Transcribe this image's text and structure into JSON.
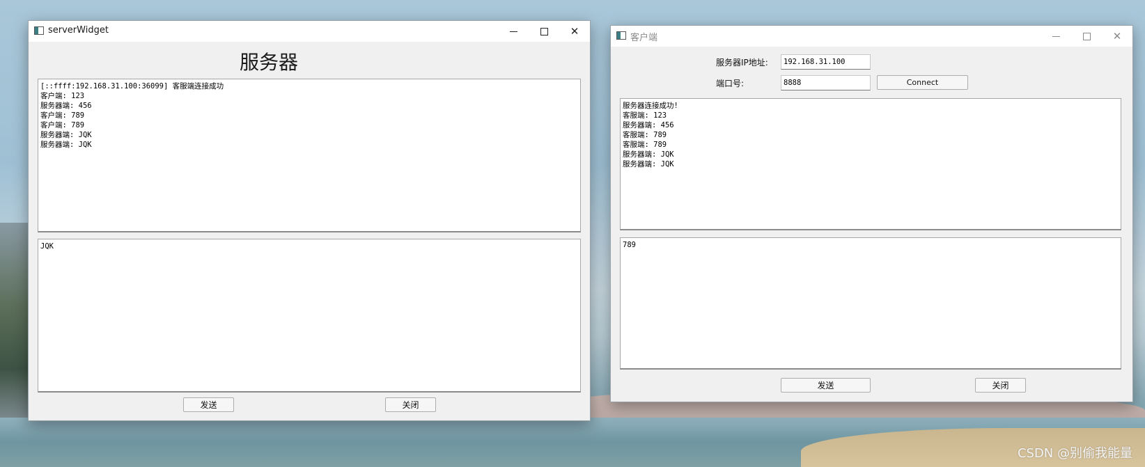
{
  "server": {
    "title": "serverWidget",
    "heading": "服务器",
    "log": [
      "[::ffff:192.168.31.100:36099] 客服端连接成功",
      "客户端: 123",
      "服务器端: 456",
      "客户端: 789",
      "客户端: 789",
      "服务器端: JQK",
      "服务器端: JQK"
    ],
    "input_text": "JQK",
    "send_label": "发送",
    "close_label": "关闭"
  },
  "client": {
    "title": "客户端",
    "ip_label": "服务器IP地址:",
    "ip_value": "192.168.31.100",
    "port_label": "端口号:",
    "port_value": "8888",
    "connect_label": "Connect",
    "log": [
      "服务器连接成功!",
      "客服端: 123",
      "服务器端: 456",
      "客服端: 789",
      "客服端: 789",
      "服务器端: JQK",
      "服务器端: JQK"
    ],
    "input_text": "789",
    "send_label": "发送",
    "close_label": "关闭"
  },
  "watermark": "CSDN @别偷我能量"
}
